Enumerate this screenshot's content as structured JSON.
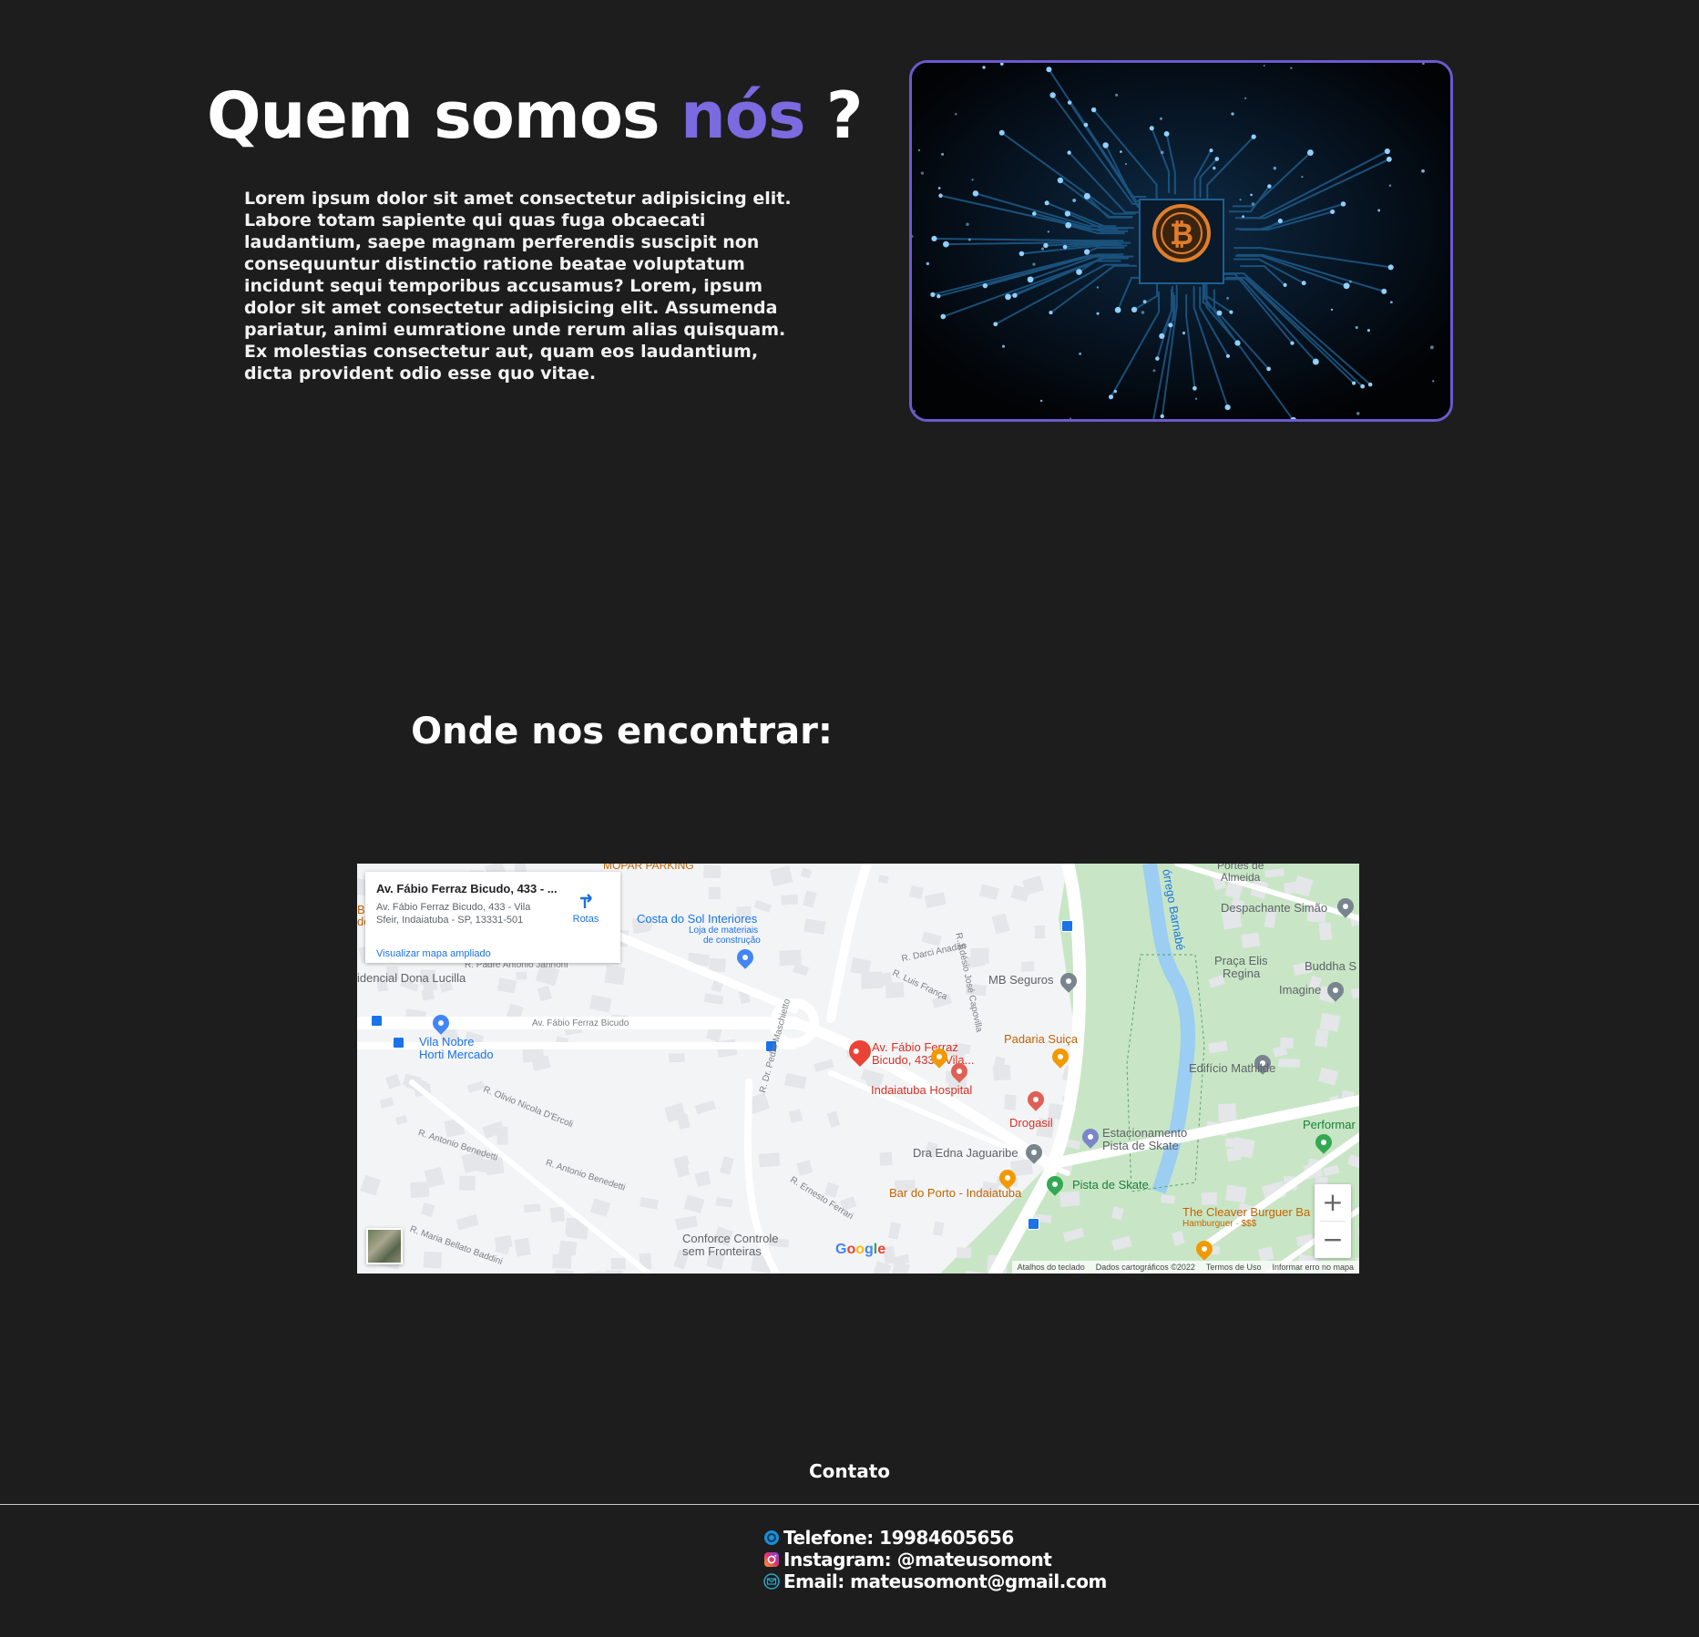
{
  "about": {
    "title_main": "Quem somos ",
    "title_accent": "nós",
    "title_end": " ?",
    "paragraph": "Lorem ipsum dolor sit amet consectetur adipisicing elit. Labore totam sapiente qui quas fuga obcaecati laudantium, saepe magnam perferendis suscipit non consequuntur distinctio ratione beatae voluptatum incidunt sequi temporibus accusamus? Lorem, ipsum dolor sit amet consectetur adipisicing elit. Assumenda pariatur, animi eumratione unde rerum alias quisquam. Ex molestias consectetur aut, quam eos laudantium, dicta provident odio esse quo vitae.",
    "image_icon": "bitcoin-circuit-image",
    "accent_color": "#7b6ae0",
    "border_color": "#6a5acd"
  },
  "map_section": {
    "title": "Onde nos encontrar:",
    "info_card": {
      "title": "Av. Fábio Ferraz Bicudo, 433 - ...",
      "address_line1": "Av. Fábio Ferraz Bicudo, 433 - Vila",
      "address_line2": "Sfeir, Indaiatuba - SP, 13331-501",
      "larger_map_link": "Visualizar mapa ampliado",
      "directions_label": "Rotas"
    },
    "labels": {
      "mopar": "MOPAR PARKING",
      "costa_sol": "Costa do Sol Interiores",
      "costa_sol_sub1": "Loja de materiais",
      "costa_sol_sub2": "de construção",
      "padre": "R. Padre Antônio Jannoni",
      "residencial": "idencial Dona Lucilla",
      "av_fabio": "Av. Fábio Ferraz Bicudo",
      "vila_nobre1": "Vila Nobre",
      "vila_nobre2": "Horti Mercado",
      "pin_label1": "Av. Fábio Ferraz",
      "pin_label2": "Bicudo, 433 - Vila...",
      "darci": "R. Darci Anadão",
      "luis": "R. Luis França",
      "edesio": "R. Edésio José Capovilla",
      "mb": "MB Seguros",
      "padaria": "Padaria Suiça",
      "hospital": "Indaiatuba Hospital",
      "drogasil": "Drogasil",
      "edna": "Dra Edna Jaguaribe",
      "estac1": "Estacionamento",
      "estac2": "Pista de Skate",
      "pista": "Pista de Skate",
      "bar": "Bar do Porto - Indaiatuba",
      "conforce1": "Conforce Controle",
      "conforce2": "sem Fronteiras",
      "olivio": "R. Olivio Nicola D'Ercoli",
      "antonio1": "R. Antonio Benedetti",
      "antonio2": "R. Antonio Benedetti",
      "maria": "R. Maria Bellato Baddini",
      "pedro": "R. Dr. Pedro Maschietto",
      "ernesto": "R. Ernesto Ferrari",
      "corrego": "órrego Barnabé",
      "portes1": "Portes de",
      "portes2": "Almeida",
      "despachante": "Despachante Simão",
      "praca1": "Praça Elis",
      "praca2": "Regina",
      "buddha": "Buddha S",
      "imagine": "Imagine",
      "mathilde": "Edifício Mathilde",
      "performa": "Performar",
      "cleaver": "The Cleaver Burguer Ba",
      "hamburguer": "Hamburguer · $$$",
      "bo": "Bo",
      "do": "do"
    },
    "zoom_in": "+",
    "zoom_out": "−",
    "google": "Google",
    "attribution": {
      "keyboard": "Atalhos do teclado",
      "data": "Dados cartográficos ©2022",
      "terms": "Termos de Uso",
      "report": "Informar erro no mapa"
    }
  },
  "footer": {
    "heading": "Contato",
    "phone": "Telefone: 19984605656",
    "instagram": "Instagram: @mateusomont",
    "email": "Email: mateusomont@gmail.com",
    "icons": [
      "whatsapp-icon",
      "instagram-icon",
      "email-icon"
    ]
  }
}
